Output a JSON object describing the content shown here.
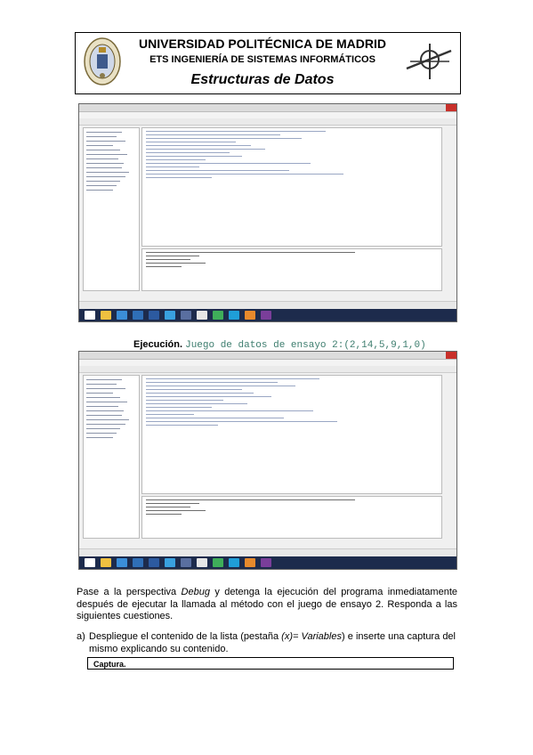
{
  "header": {
    "university": "UNIVERSIDAD POLITÉCNICA DE MADRID",
    "school": "ETS INGENIERÍA DE SISTEMAS INFORMÁTICOS",
    "course": "Estructuras de Datos"
  },
  "execution": {
    "label": "Ejecución.",
    "dataset": "Juego de datos de ensayo 2:(2,14,5,9,1,0)"
  },
  "instructions": {
    "paragraph_parts": [
      "Pase a la perspectiva ",
      "Debug",
      " y detenga la ejecución del programa inmediatamente después de ejecutar la llamada al método con el juego de ensayo 2. Responda a las siguientes cuestiones."
    ],
    "question_marker": "a)",
    "question_parts": [
      "Despliegue el contenido de la lista (pestaña ",
      "(x)= Variables",
      ") e inserte una captura del mismo explicando su contenido."
    ],
    "capture_label": "Captura."
  },
  "colors": {
    "taskbar": "#1d2b4c",
    "close_button": "#c8302a",
    "dataset_code": "#3d7d6e"
  }
}
